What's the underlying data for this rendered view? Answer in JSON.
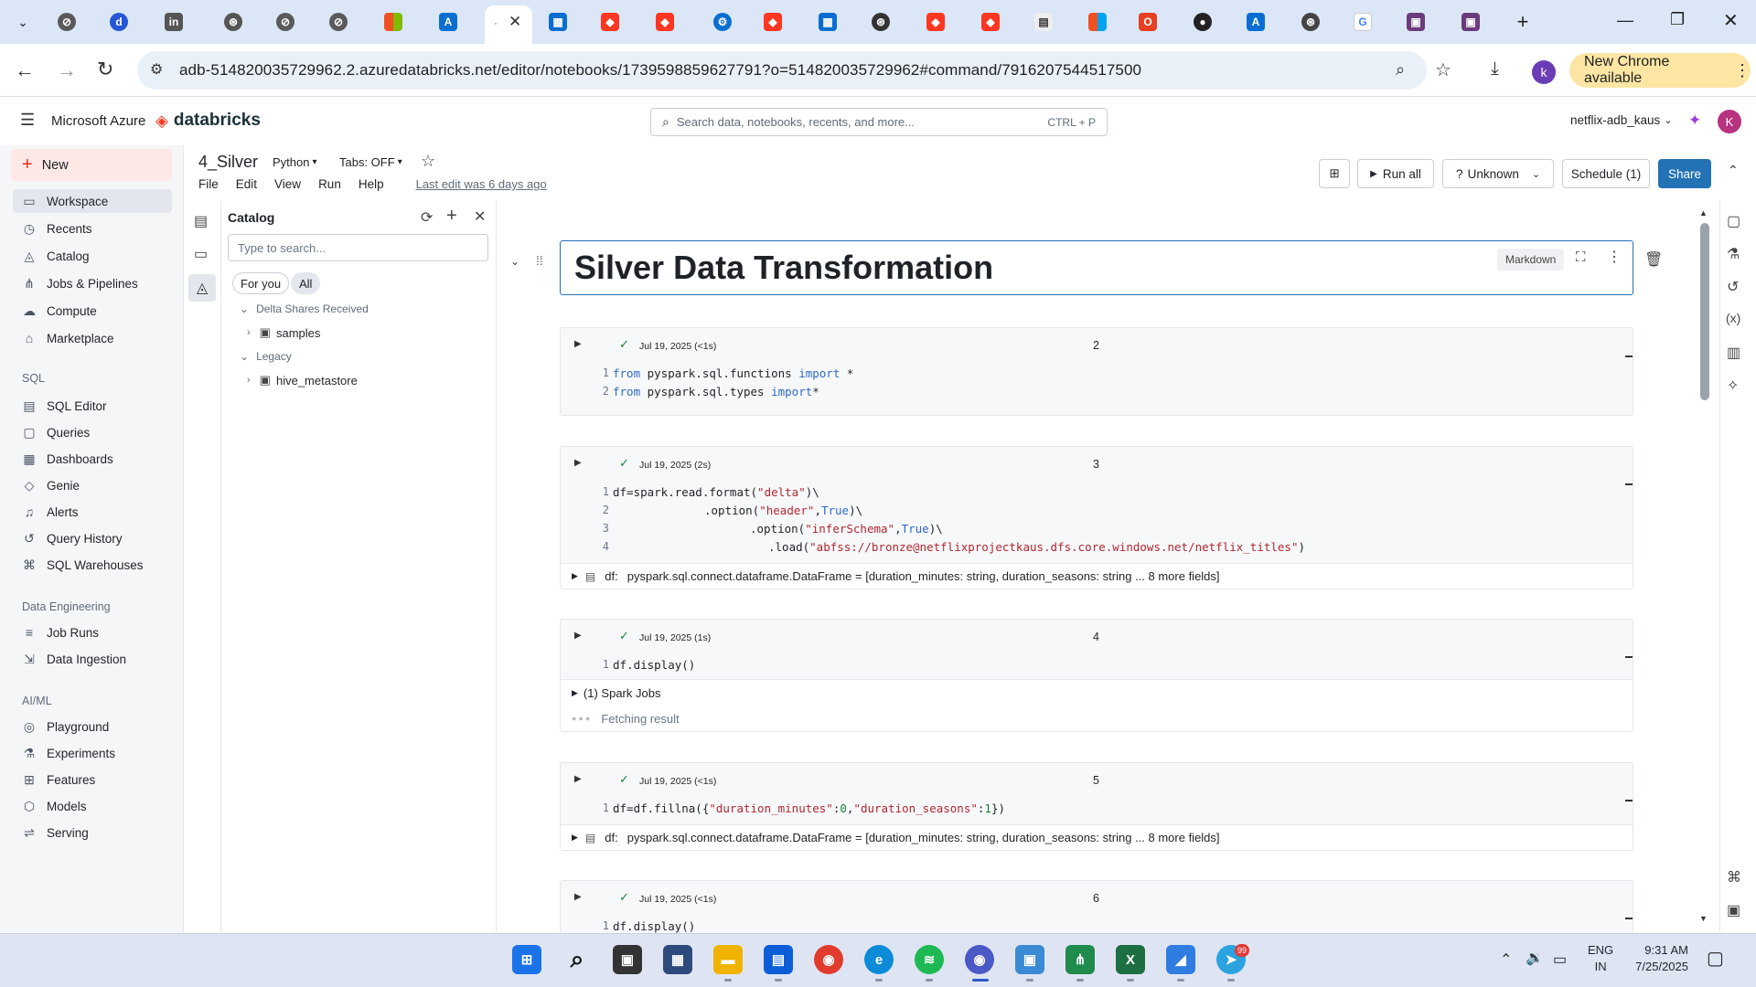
{
  "browser": {
    "url": "adb-514820035729962.2.azuredatabricks.net/editor/notebooks/1739598859627791?o=514820035729962#command/7916207544517500",
    "new_chrome": "New Chrome available",
    "profile_initial": "k"
  },
  "header": {
    "azure": "Microsoft Azure",
    "brand": "databricks",
    "search_placeholder": "Search data, notebooks, recents, and more...",
    "search_shortcut": "CTRL + P",
    "workspace": "netflix-adb_kaus",
    "user_initial": "K"
  },
  "sidebar": {
    "new_label": "New",
    "items": [
      {
        "label": "Workspace",
        "icon": "folder-icon"
      },
      {
        "label": "Recents",
        "icon": "clock-icon"
      },
      {
        "label": "Catalog",
        "icon": "catalog-icon"
      },
      {
        "label": "Jobs & Pipelines",
        "icon": "workflow-icon"
      },
      {
        "label": "Compute",
        "icon": "cloud-icon"
      },
      {
        "label": "Marketplace",
        "icon": "store-icon"
      }
    ],
    "sql_title": "SQL",
    "sql_items": [
      {
        "label": "SQL Editor",
        "icon": "editor-icon"
      },
      {
        "label": "Queries",
        "icon": "query-icon"
      },
      {
        "label": "Dashboards",
        "icon": "dashboard-icon"
      },
      {
        "label": "Genie",
        "icon": "genie-icon"
      },
      {
        "label": "Alerts",
        "icon": "bell-icon"
      },
      {
        "label": "Query History",
        "icon": "history-icon"
      },
      {
        "label": "SQL Warehouses",
        "icon": "warehouse-icon"
      }
    ],
    "de_title": "Data Engineering",
    "de_items": [
      {
        "label": "Job Runs",
        "icon": "list-icon"
      },
      {
        "label": "Data Ingestion",
        "icon": "ingest-icon"
      }
    ],
    "ml_title": "AI/ML",
    "ml_items": [
      {
        "label": "Playground",
        "icon": "playground-icon"
      },
      {
        "label": "Experiments",
        "icon": "flask-icon"
      },
      {
        "label": "Features",
        "icon": "features-icon"
      },
      {
        "label": "Models",
        "icon": "model-icon"
      },
      {
        "label": "Serving",
        "icon": "serving-icon"
      }
    ]
  },
  "notebook": {
    "title": "4_Silver",
    "language": "Python",
    "tabs": "Tabs: OFF",
    "menu": [
      "File",
      "Edit",
      "View",
      "Run",
      "Help"
    ],
    "last_edit": "Last edit was 6 days ago",
    "run_all": "Run all",
    "compute": "Unknown",
    "schedule": "Schedule (1)",
    "share": "Share"
  },
  "catalog": {
    "title": "Catalog",
    "search_placeholder": "Type to search...",
    "filters": [
      "For you",
      "All"
    ],
    "delta_shares": "Delta Shares Received",
    "samples": "samples",
    "legacy": "Legacy",
    "hive": "hive_metastore"
  },
  "cells": {
    "markdown_title": "Silver Data Transformation",
    "markdown_badge": "Markdown",
    "c2": {
      "meta": "Jul 19, 2025 (<1s)",
      "num": "2"
    },
    "c3": {
      "meta": "Jul 19, 2025 (2s)",
      "num": "3",
      "out": "pyspark.sql.connect.dataframe.DataFrame = [duration_minutes: string, duration_seasons: string ... 8 more fields]"
    },
    "c4": {
      "meta": "Jul 19, 2025 (1s)",
      "num": "4",
      "jobs": "(1) Spark Jobs",
      "fetch": "Fetching result"
    },
    "c5": {
      "meta": "Jul 19, 2025 (<1s)",
      "num": "5",
      "out": "pyspark.sql.connect.dataframe.DataFrame = [duration_minutes: string, duration_seasons: string ... 8 more fields]"
    },
    "c6": {
      "meta": "Jul 19, 2025 (<1s)",
      "num": "6"
    },
    "df_label": "df:"
  },
  "taskbar": {
    "lang": "ENG",
    "region": "IN",
    "time": "9:31 AM",
    "date": "7/25/2025",
    "telegram_badge": "99"
  }
}
